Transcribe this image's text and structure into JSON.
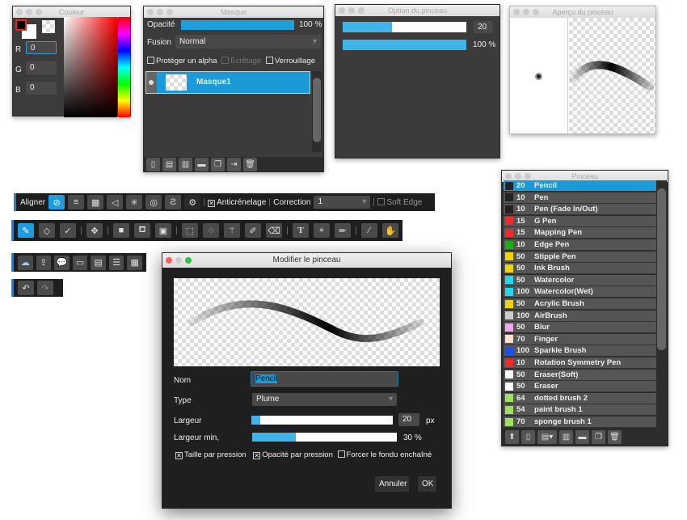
{
  "color_panel": {
    "title": "Couleur",
    "r_label": "R",
    "g_label": "G",
    "b_label": "B",
    "r": "0",
    "g": "0",
    "b": "0"
  },
  "mask_panel": {
    "title": "Masque",
    "opacity_label": "Opacité",
    "opacity_value": "100 %",
    "opacity": 100,
    "blend_label": "Fusion",
    "blend_value": "Normal",
    "protect_alpha": "Protéger un alpha",
    "clipping": "Écrêtage",
    "lock": "Verrouillage",
    "layers": [
      {
        "name": "Masque1"
      }
    ]
  },
  "brush_option_panel": {
    "title": "Option du pinceau",
    "size_value": "20",
    "size_fraction": 0.4,
    "opacity_value": "100 %",
    "opacity": 100
  },
  "brush_preview_panel": {
    "title": "Aperçu du pinceau"
  },
  "align_toolbar": {
    "label": "Aligner",
    "antialias": "Anticrénelage",
    "correction_label": "Correction",
    "correction_value": "1",
    "soft_edge": "Soft Edge"
  },
  "brush_panel": {
    "title": "Pinceau",
    "brushes": [
      {
        "size": "20",
        "name": "Pencil",
        "color": "#222222",
        "selected": true
      },
      {
        "size": "10",
        "name": "Pen",
        "color": "#222222"
      },
      {
        "size": "10",
        "name": "Pen (Fade In/Out)",
        "color": "#222222"
      },
      {
        "size": "15",
        "name": "G Pen",
        "color": "#ee2a2a"
      },
      {
        "size": "15",
        "name": "Mapping Pen",
        "color": "#ee2a2a"
      },
      {
        "size": "10",
        "name": "Edge Pen",
        "color": "#16b016"
      },
      {
        "size": "50",
        "name": "Stipple Pen",
        "color": "#f2d400"
      },
      {
        "size": "50",
        "name": "Ink Brush",
        "color": "#f2d400"
      },
      {
        "size": "50",
        "name": "Watercolor",
        "color": "#22d8f0"
      },
      {
        "size": "100",
        "name": "Watercolor(Wet)",
        "color": "#22d8f0"
      },
      {
        "size": "50",
        "name": "Acrylic Brush",
        "color": "#f2d400"
      },
      {
        "size": "100",
        "name": "AirBrush",
        "color": "#cccccc"
      },
      {
        "size": "50",
        "name": "Blur",
        "color": "#f0a8f0"
      },
      {
        "size": "70",
        "name": "Finger",
        "color": "#fbe0cc"
      },
      {
        "size": "100",
        "name": "Sparkle Brush",
        "color": "#1f4ef0"
      },
      {
        "size": "10",
        "name": "Rotation Symmetry Pen",
        "color": "#ee2a2a"
      },
      {
        "size": "50",
        "name": "Eraser(Soft)",
        "color": "#ffffff"
      },
      {
        "size": "50",
        "name": "Eraser",
        "color": "#ffffff"
      },
      {
        "size": "64",
        "name": "dotted brush 2",
        "color": "#9ee060"
      },
      {
        "size": "54",
        "name": "paint brush 1",
        "color": "#9ee060"
      },
      {
        "size": "70",
        "name": "sponge brush 1",
        "color": "#9ee060"
      }
    ]
  },
  "dialog": {
    "title": "Modifier le pinceau",
    "name_label": "Nom",
    "name_value": "Pencil",
    "type_label": "Type",
    "type_value": "Plume",
    "width_label": "Largeur",
    "width_value": "20",
    "width_unit": "px",
    "width_fraction": 0.06,
    "min_width_label": "Largeur min,",
    "min_width_value": "30 %",
    "min_width": 30,
    "size_pressure": "Taille par pression",
    "opacity_pressure": "Opacité par pression",
    "force_fade": "Forcer le fondu enchaîné",
    "size_pressure_checked": true,
    "opacity_pressure_checked": true,
    "force_fade_checked": false,
    "cancel": "Annuler",
    "ok": "OK"
  },
  "colors": {
    "accent": "#1a9ad6",
    "panel": "#3c3a3a"
  }
}
